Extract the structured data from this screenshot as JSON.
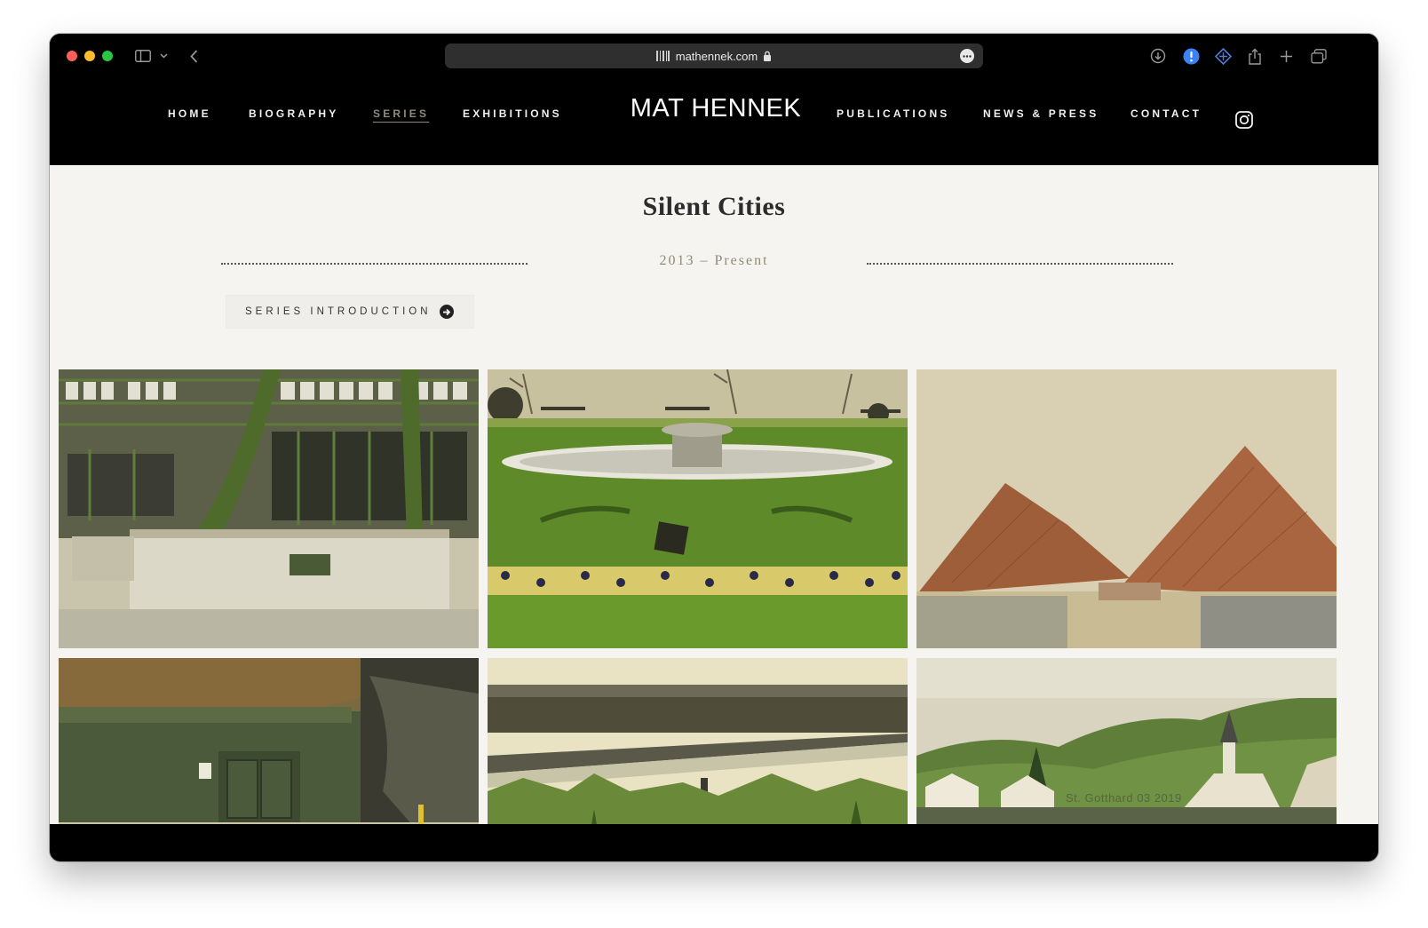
{
  "browser": {
    "url": "mathennek.com",
    "icons": [
      "sidebar-icon",
      "chevron-down-icon",
      "back-icon",
      "download-icon",
      "alert-icon",
      "extension-icon",
      "share-icon",
      "new-tab-icon",
      "tabs-overview-icon"
    ]
  },
  "header": {
    "brand": "MAT HENNEK",
    "nav_left": [
      "HOME",
      "BIOGRAPHY",
      "SERIES",
      "EXHIBITIONS"
    ],
    "nav_right": [
      "PUBLICATIONS",
      "NEWS & PRESS",
      "CONTACT"
    ],
    "active": "SERIES",
    "social_icon": "instagram-icon"
  },
  "series": {
    "title": "Silent Cities",
    "years": "2013 – Present",
    "intro_button": "SERIES INTRODUCTION"
  },
  "gallery": {
    "images": [
      {
        "subject": "greenhouse-steel-frame"
      },
      {
        "subject": "park-fountain-lawn"
      },
      {
        "subject": "copper-pyramid-roofs"
      },
      {
        "subject": "bunker-tunnel-entrance"
      },
      {
        "subject": "highway-overpass"
      },
      {
        "subject": "alpine-village"
      }
    ],
    "hover_caption": "St. Gotthard 03 2019"
  },
  "colors": {
    "header_bg": "#000000",
    "page_bg": "#f5f4f1",
    "active_nav": "#8f8a7a",
    "years_text": "#8f8a74"
  }
}
